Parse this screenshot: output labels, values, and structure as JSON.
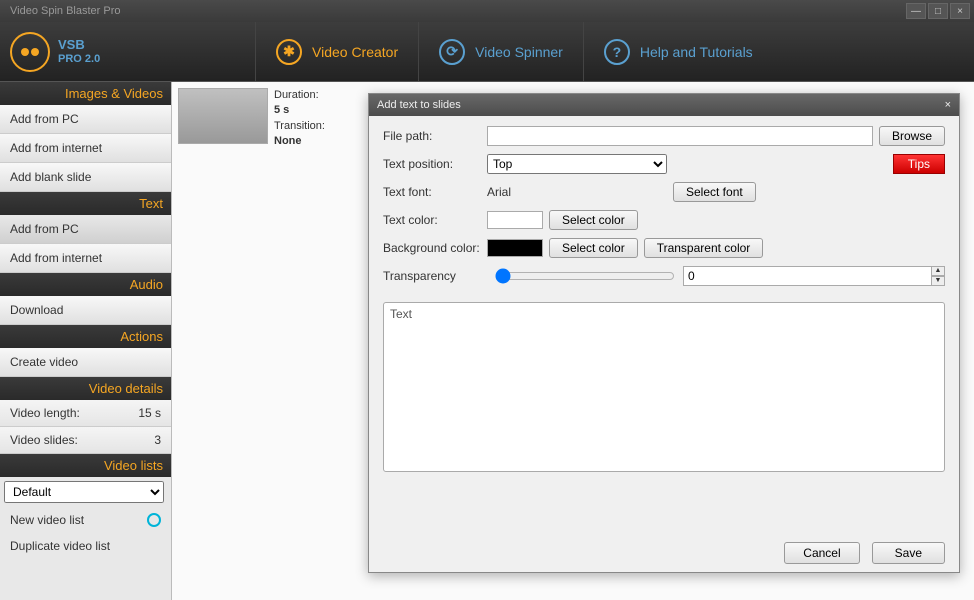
{
  "window": {
    "title": "Video Spin Blaster Pro"
  },
  "logo": {
    "brand": "VSB",
    "sub": "PRO 2.0"
  },
  "nav": {
    "creator": "Video Creator",
    "spinner": "Video Spinner",
    "help": "Help and Tutorials"
  },
  "sidebar": {
    "images_videos": {
      "header": "Images & Videos",
      "items": [
        "Add from PC",
        "Add from internet",
        "Add blank slide"
      ]
    },
    "text": {
      "header": "Text",
      "items": [
        "Add from PC",
        "Add from internet"
      ]
    },
    "audio": {
      "header": "Audio",
      "items": [
        "Download"
      ]
    },
    "actions": {
      "header": "Actions",
      "items": [
        "Create video"
      ]
    },
    "details": {
      "header": "Video details",
      "length_label": "Video length:",
      "length_value": "15 s",
      "slides_label": "Video slides:",
      "slides_value": "3"
    },
    "lists": {
      "header": "Video lists",
      "selected": "Default",
      "new_list": "New video list",
      "duplicate": "Duplicate video list"
    }
  },
  "thumb": {
    "duration_label": "Duration:",
    "duration_value": "5 s",
    "transition_label": "Transition:",
    "transition_value": "None"
  },
  "dialog": {
    "title": "Add text to slides",
    "filepath_label": "File path:",
    "browse": "Browse",
    "position_label": "Text position:",
    "position_value": "Top",
    "tips": "Tips",
    "font_label": "Text font:",
    "font_value": "Arial",
    "select_font": "Select font",
    "textcolor_label": "Text color:",
    "select_color": "Select color",
    "bgcolor_label": "Background color:",
    "transparent_color": "Transparent color",
    "transparency_label": "Transparency",
    "transparency_value": "0",
    "textarea_label": "Text",
    "cancel": "Cancel",
    "save": "Save"
  }
}
